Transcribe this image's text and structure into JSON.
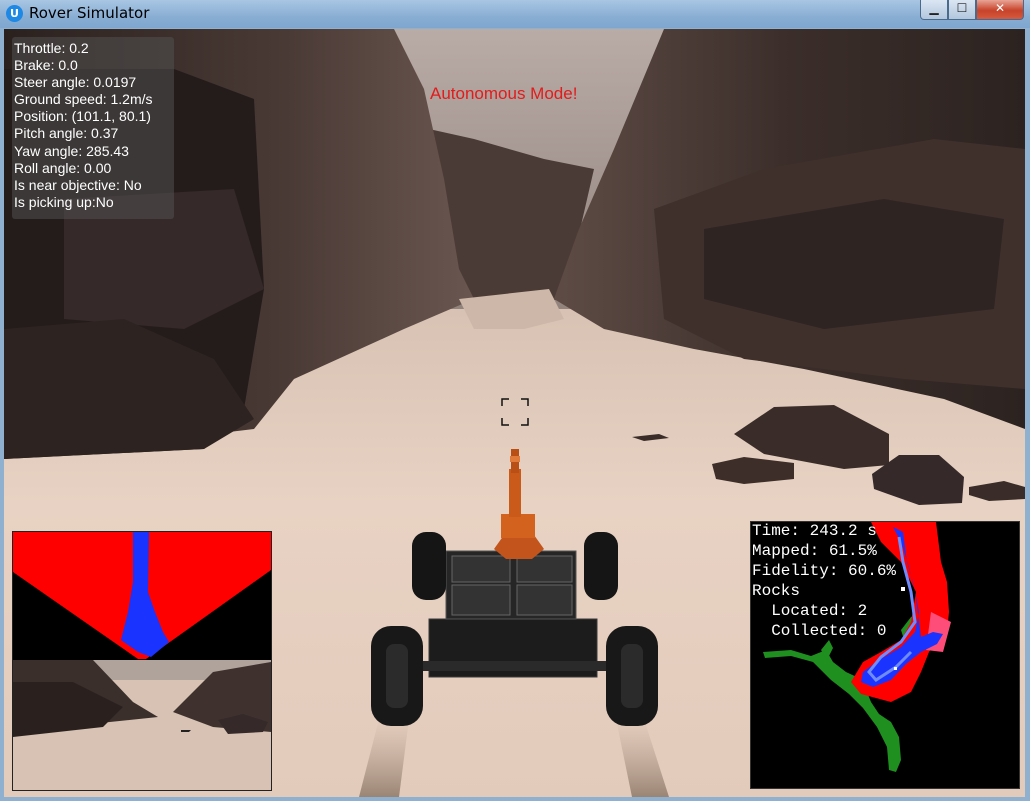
{
  "window": {
    "title": "Rover Simulator",
    "icon": "unity-icon",
    "controls": [
      "minimize",
      "maximize",
      "close"
    ]
  },
  "telemetry": {
    "throttle": "Throttle: 0.2",
    "brake": "Brake: 0.0",
    "steer": "Steer angle: 0.0197",
    "speed": "Ground speed: 1.2m/s",
    "position": "Position: (101.1, 80.1)",
    "pitch": "Pitch angle: 0.37",
    "yaw": "Yaw angle: 285.43",
    "roll": "Roll angle: 0.00",
    "near_objective": "Is near objective: No",
    "picking_up": "Is picking up:No"
  },
  "mode_text": "Autonomous Mode!",
  "map": {
    "time": "Time: 243.2 s",
    "mapped": "Mapped: 61.5%",
    "fidelity": "Fidelity: 60.6%",
    "rocks": "Rocks",
    "located": "  Located: 2",
    "collected": "  Collected: 0"
  },
  "colors": {
    "mode_text": "#e11c1c",
    "navigable": "#1a33ff",
    "obstacle": "#ff0000",
    "ground_truth": "#1f8f1f",
    "terrain": "#e3cbbb",
    "rock": "#3a2c28"
  }
}
